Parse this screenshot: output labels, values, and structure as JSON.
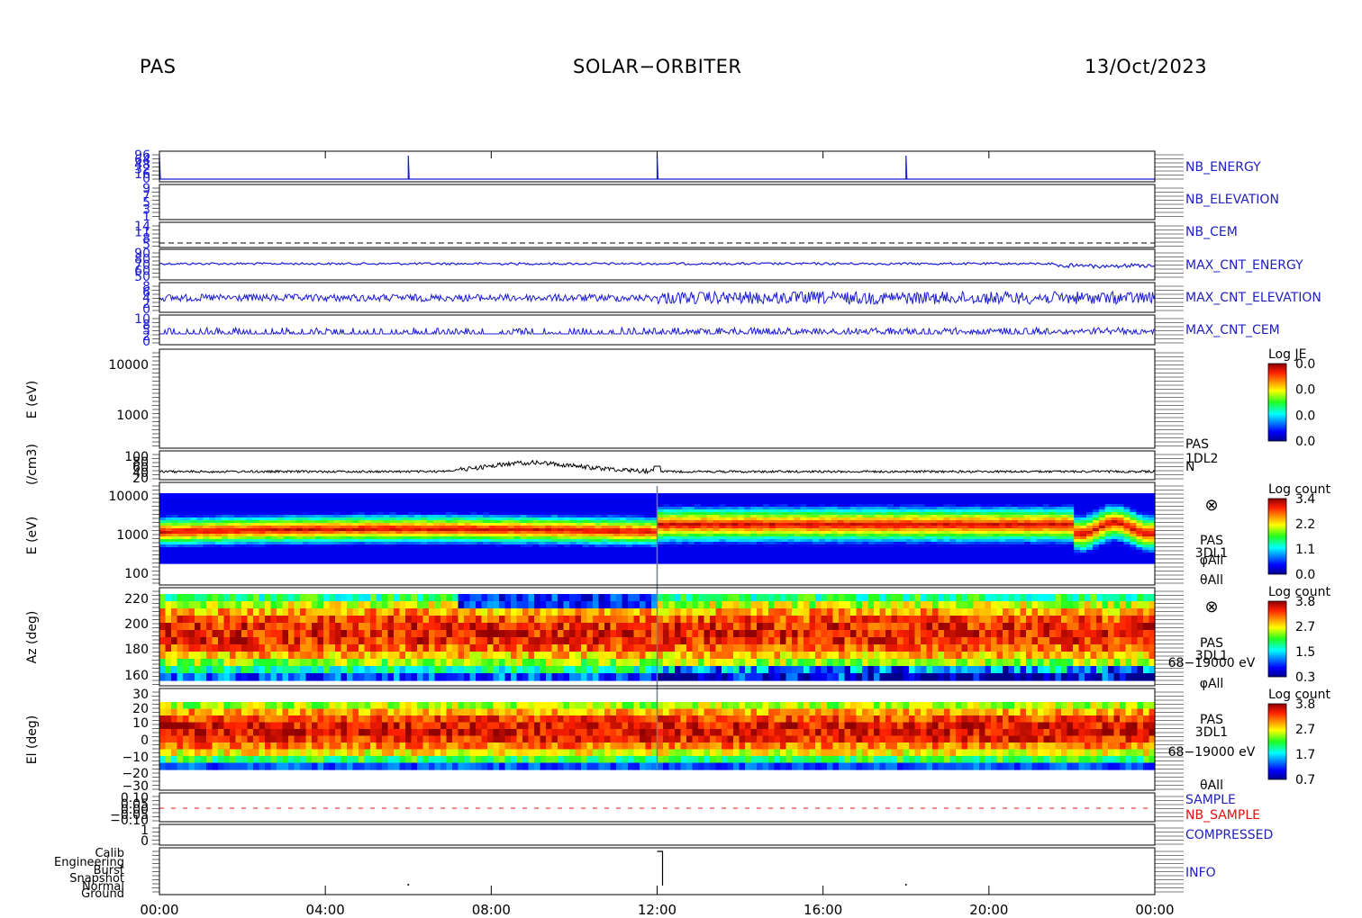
{
  "header": {
    "left": "PAS",
    "center": "SOLAR−ORBITER",
    "right": "13/Oct/2023"
  },
  "colors": {
    "trace": "#1a1ad6",
    "label_blue": "#2020c0",
    "label_red": "#e01010",
    "density": "#000000"
  },
  "chart_data": [
    {
      "type": "line",
      "name": "NB_ENERGY",
      "label": "NB_ENERGY",
      "y_ticks": [
        "96",
        "64",
        "48",
        "32",
        "16",
        "0"
      ],
      "description_values": "flat near 0 with spikes at 00:00, 06:00, 12:00, 18:00"
    },
    {
      "type": "line",
      "name": "NB_ELEVATION",
      "label": "NB_ELEVATION",
      "y_ticks": [
        "9",
        "7",
        "5",
        "3",
        "1"
      ]
    },
    {
      "type": "line",
      "name": "NB_CEM",
      "label": "NB_CEM",
      "y_ticks": [
        "14",
        "11",
        "8",
        "5"
      ]
    },
    {
      "type": "line",
      "name": "MAX_CNT_ENERGY",
      "label": "MAX_CNT_ENERGY",
      "y_ticks": [
        "90",
        "80",
        "70",
        "60",
        "50"
      ]
    },
    {
      "type": "line",
      "name": "MAX_CNT_ELEVATION",
      "label": "MAX_CNT_ELEVATION",
      "y_ticks": [
        "8",
        "6",
        "4",
        "2",
        "0"
      ]
    },
    {
      "type": "line",
      "name": "MAX_CNT_CEM",
      "label": "MAX_CNT_CEM",
      "y_ticks": [
        "10",
        "8",
        "5",
        "2",
        "0"
      ]
    },
    {
      "type": "heatmap",
      "name": "E (eV) 1DL2",
      "ylabel": "E (eV)",
      "y_ticks": [
        "10000",
        "1000"
      ],
      "colorbar": {
        "title": "Log JE",
        "ticks": [
          "0.0",
          "0.0",
          "0.0",
          "0.0"
        ]
      }
    },
    {
      "type": "line",
      "name": "N",
      "ylabel": "(/cm3)",
      "y_ticks": [
        "100",
        "80",
        "60",
        "40",
        "20"
      ],
      "side_labels": [
        "PAS",
        "1DL2",
        "N"
      ]
    },
    {
      "type": "heatmap",
      "name": "E (eV) 3DL1",
      "ylabel": "E (eV)",
      "y_ticks": [
        "10000",
        "1000",
        "100"
      ],
      "colorbar": {
        "title": "Log count",
        "ticks": [
          "3.4",
          "2.2",
          "1.1",
          "0.0"
        ]
      },
      "side_labels": [
        "⊗",
        "PAS",
        "3DL1",
        "φAll",
        "θAll"
      ]
    },
    {
      "type": "heatmap",
      "name": "Az (deg)",
      "ylabel": "Az (deg)",
      "y_ticks": [
        "220",
        "200",
        "180",
        "160"
      ],
      "colorbar": {
        "title": "Log count",
        "ticks": [
          "3.8",
          "2.7",
          "1.5",
          "0.3"
        ]
      },
      "side_labels": [
        "⊗",
        "PAS",
        "3DL1",
        "68−19000 eV",
        "φAll"
      ]
    },
    {
      "type": "heatmap",
      "name": "El (deg)",
      "ylabel": "El (deg)",
      "y_ticks": [
        "30",
        "20",
        "10",
        "0",
        "−10",
        "−20",
        "−30"
      ],
      "colorbar": {
        "title": "Log count",
        "ticks": [
          "3.8",
          "2.7",
          "1.7",
          "0.7"
        ]
      },
      "side_labels": [
        "PAS",
        "3DL1",
        "68−19000 eV",
        "θAll"
      ]
    },
    {
      "type": "line",
      "name": "SAMPLE",
      "labels": [
        "SAMPLE",
        "NB_SAMPLE"
      ],
      "y_ticks": [
        "0.10",
        "0.05",
        "0.00",
        "−0.05",
        "−0.10"
      ]
    },
    {
      "type": "line",
      "name": "COMPRESSED",
      "label": "COMPRESSED",
      "y_ticks": [
        "1",
        "0"
      ]
    },
    {
      "type": "line",
      "name": "INFO",
      "label": "INFO",
      "y_ticks": [
        "Calib",
        "Engineering",
        "Burst",
        "Snapshot",
        "Normal",
        "Ground"
      ]
    }
  ],
  "x_axis": {
    "ticks": [
      "00:00",
      "04:00",
      "08:00",
      "12:00",
      "16:00",
      "20:00",
      "00:00"
    ]
  }
}
